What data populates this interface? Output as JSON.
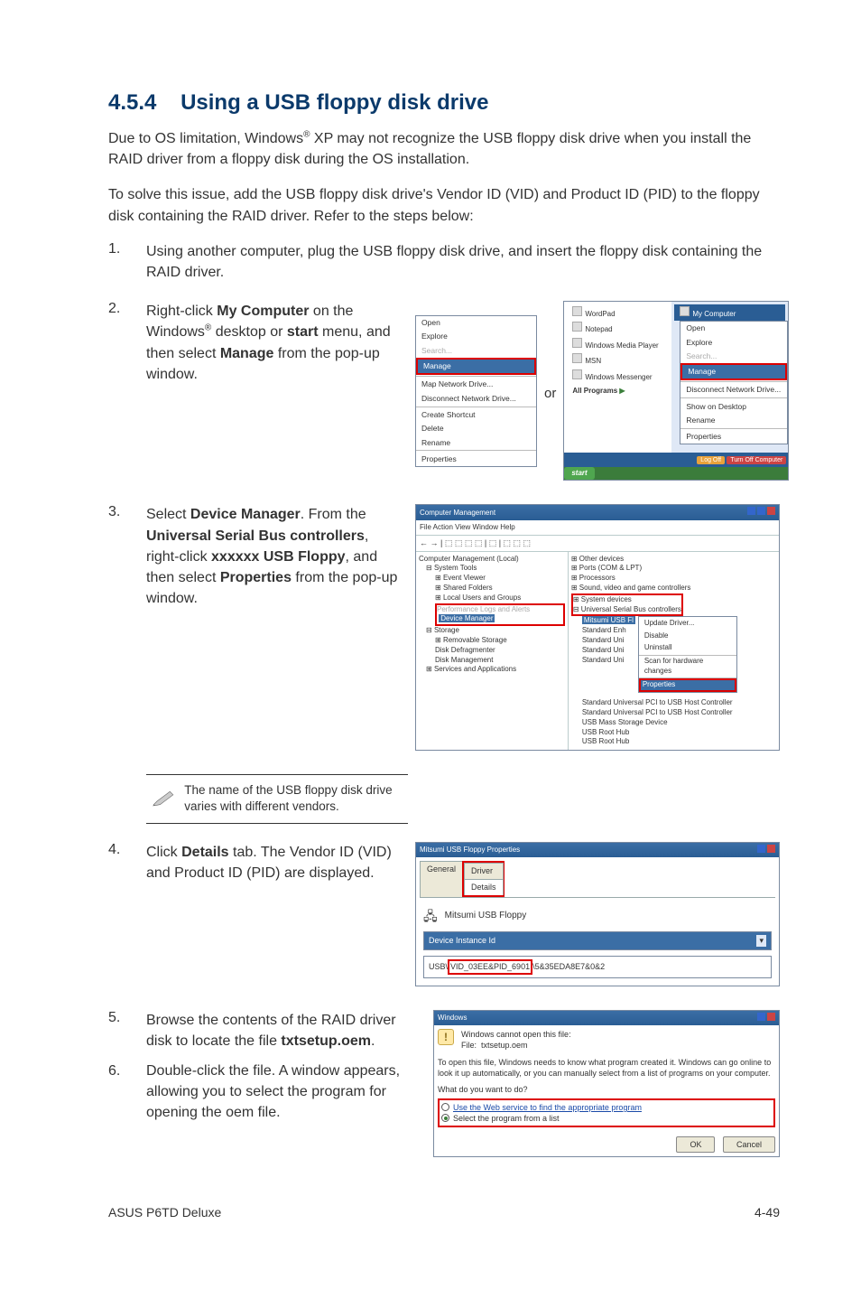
{
  "section": {
    "number": "4.5.4",
    "title": "Using a USB floppy disk drive"
  },
  "intro1_a": "Due to OS limitation, Windows",
  "intro1_sup": "®",
  "intro1_b": " XP may not recognize the USB floppy disk drive when you install the RAID driver from a floppy disk during the OS installation.",
  "intro2": "To solve this issue, add the USB floppy disk drive's Vendor ID (VID) and Product ID (PID) to the floppy disk containing the RAID driver. Refer to the steps below:",
  "steps": {
    "s1_num": "1.",
    "s1": "Using another computer, plug the USB floppy disk drive, and insert the floppy disk containing the RAID driver.",
    "s2_num": "2.",
    "s2_a": "Right-click ",
    "s2_b": "My Computer",
    "s2_c": " on the Windows",
    "s2_sup": "®",
    "s2_d": " desktop or ",
    "s2_e": "start",
    "s2_f": " menu, and then select ",
    "s2_g": "Manage",
    "s2_h": " from the pop-up window.",
    "s3_num": "3.",
    "s3_a": "Select ",
    "s3_b": "Device Manager",
    "s3_c": ". From the ",
    "s3_d": "Universal Serial Bus controllers",
    "s3_e": ", right-click ",
    "s3_f": "xxxxxx USB Floppy",
    "s3_g": ", and then select ",
    "s3_h": "Properties",
    "s3_i": " from the pop-up window.",
    "s4_num": "4.",
    "s4_a": "Click ",
    "s4_b": "Details",
    "s4_c": " tab. The Vendor ID (VID) and Product ID (PID) are displayed.",
    "s5_num": "5.",
    "s5_a": "Browse the contents of the RAID driver disk to locate the file ",
    "s5_b": "txtsetup.oem",
    "s5_c": ".",
    "s6_num": "6.",
    "s6": "Double-click the file. A window appears, allowing you to select the program for opening the oem file."
  },
  "note": "The name of the USB floppy disk drive varies with different vendors.",
  "or_label": "or",
  "ctx_menu": {
    "open": "Open",
    "explore": "Explore",
    "search": "Search...",
    "manage": "Manage",
    "map": "Map Network Drive...",
    "disc": "Disconnect Network Drive...",
    "shortcut": "Create Shortcut",
    "delete": "Delete",
    "rename": "Rename",
    "props": "Properties"
  },
  "start_menu": {
    "wordpad": "WordPad",
    "notepad": "Notepad",
    "wmp": "Windows Media Player",
    "msn": "MSN",
    "messenger": "Windows Messenger",
    "allprog": "All Programs",
    "start": "start",
    "myc": "My Computer",
    "open": "Open",
    "explore": "Explore",
    "search": "Search...",
    "manage": "Manage",
    "discnet": "Disconnect Network Drive...",
    "showdesk": "Show on Desktop",
    "rename": "Rename",
    "props": "Properties",
    "logoff": "Log Off",
    "turnoff": "Turn Off Computer"
  },
  "compmgmt": {
    "title": "Computer Management",
    "menus": "File   Action   View   Window   Help",
    "left": {
      "root": "Computer Management (Local)",
      "systools": "System Tools",
      "evt": "Event Viewer",
      "shared": "Shared Folders",
      "users": "Local Users and Groups",
      "alerts": "Performance Logs and Alerts",
      "devmgr": "Device Manager",
      "storage": "Storage",
      "remov": "Removable Storage",
      "defrag": "Disk Defragmenter",
      "diskmg": "Disk Management",
      "svc": "Services and Applications"
    },
    "right": {
      "other": "Other devices",
      "ports": "Ports (COM & LPT)",
      "proc": "Processors",
      "sound": "Sound, video and game controllers",
      "sysdev": "System devices",
      "usbctrl": "Universal Serial Bus controllers",
      "mitsumi": "Mitsumi USB Fl",
      "update": "Update Driver...",
      "disable": "Disable",
      "uninstall": "Uninstall",
      "scan": "Scan for hardware changes",
      "props": "Properties",
      "std": "Standard Enh",
      "std2": "Standard Uni",
      "std3": "Standard Uni",
      "std4": "Standard Uni",
      "std5": "Standard Universal PCI to USB Host Controller",
      "std6": "Standard Universal PCI to USB Host Controller",
      "mass": "USB Mass Storage Device",
      "root1": "USB Root Hub",
      "root2": "USB Root Hub"
    }
  },
  "propdlg": {
    "title": "Mitsumi USB Floppy Properties",
    "tab_general": "General",
    "tab_driver": "Driver",
    "tab_details": "Details",
    "devname": "Mitsumi USB Floppy",
    "dropdown": "Device Instance Id",
    "value_pre": "USB\\",
    "value_mid": "VID_03EE&PID_6901",
    "value_post": "\\5&35EDA8E7&0&2"
  },
  "opendlg": {
    "title": "Windows",
    "cant": "Windows cannot open this file:",
    "file_lbl": "File:",
    "file_val": "txtsetup.oem",
    "para": "To open this file, Windows needs to know what program created it. Windows can go online to look it up automatically, or you can manually select from a list of programs on your computer.",
    "what": "What do you want to do?",
    "opt1": "Use the Web service to find the appropriate program",
    "opt2": "Select the program from a list",
    "ok": "OK",
    "cancel": "Cancel"
  },
  "footer": {
    "left": "ASUS P6TD Deluxe",
    "right": "4-49"
  }
}
